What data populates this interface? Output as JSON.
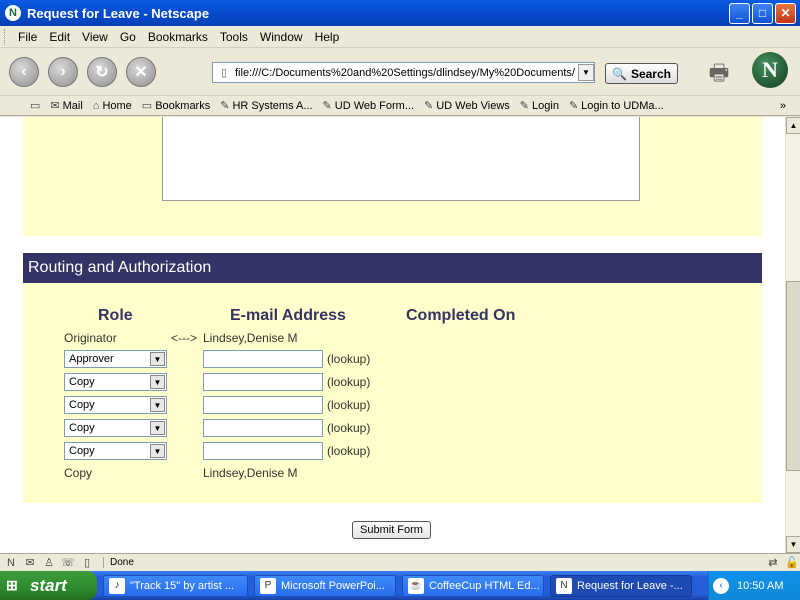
{
  "window": {
    "title": "Request for Leave - Netscape",
    "app_icon": "N",
    "controls": {
      "minimize": "_",
      "maximize": "□",
      "close": "✕"
    }
  },
  "menu": [
    "File",
    "Edit",
    "View",
    "Go",
    "Bookmarks",
    "Tools",
    "Window",
    "Help"
  ],
  "nav": {
    "url": "file:///C:/Documents%20and%20Settings/dlindsey/My%20Documents/",
    "search_label": "Search",
    "logo": "N"
  },
  "personal_toolbar": {
    "items": [
      "Mail",
      "Home",
      "Bookmarks",
      "HR Systems A...",
      "UD Web Form...",
      "UD Web Views",
      "Login",
      "Login to UDMa..."
    ],
    "overflow": "»"
  },
  "routing": {
    "header": "Routing and Authorization",
    "columns": {
      "role": "Role",
      "email": "E-mail Address",
      "completed": "Completed On"
    },
    "originator": {
      "role": "Originator",
      "arrow": "<--->",
      "name": "Lindsey,Denise M"
    },
    "rows": [
      {
        "role": "Approver",
        "email": "",
        "lookup": "(lookup)"
      },
      {
        "role": "Copy",
        "email": "",
        "lookup": "(lookup)"
      },
      {
        "role": "Copy",
        "email": "",
        "lookup": "(lookup)"
      },
      {
        "role": "Copy",
        "email": "",
        "lookup": "(lookup)"
      },
      {
        "role": "Copy",
        "email": "",
        "lookup": "(lookup)"
      }
    ],
    "final_copy": {
      "role": "Copy",
      "name": "Lindsey,Denise M"
    },
    "submit_label": "Submit Form"
  },
  "status": {
    "text": "Done"
  },
  "taskbar": {
    "start_label": "start",
    "items": [
      {
        "label": "\"Track 15\" by artist ...",
        "active": false
      },
      {
        "label": "Microsoft PowerPoi...",
        "active": false
      },
      {
        "label": "CoffeeCup HTML Ed...",
        "active": false
      },
      {
        "label": "Request for Leave -...",
        "active": true
      }
    ],
    "clock": "10:50 AM"
  }
}
